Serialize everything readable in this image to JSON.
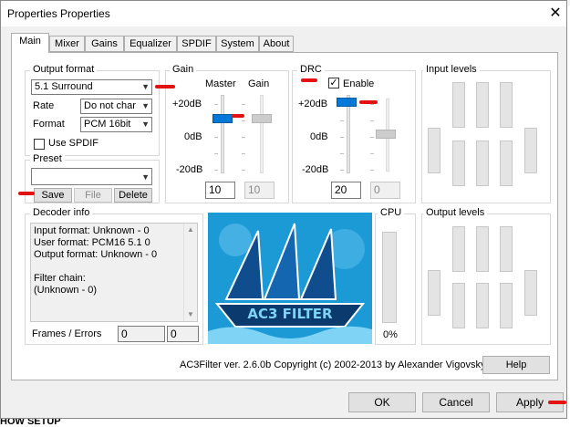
{
  "window": {
    "title": "Properties Properties",
    "close_glyph": "✕"
  },
  "tabs": [
    "Main",
    "Mixer",
    "Gains",
    "Equalizer",
    "SPDIF",
    "System",
    "About"
  ],
  "output_format": {
    "group_label": "Output format",
    "format_value": "5.1 Surround",
    "rate_label": "Rate",
    "rate_value": "Do not char",
    "format_label": "Format",
    "format_select_value": "PCM 16bit",
    "use_spdif_label": "Use SPDIF"
  },
  "preset": {
    "group_label": "Preset",
    "value": "",
    "save_label": "Save",
    "file_label": "File",
    "delete_label": "Delete"
  },
  "gain": {
    "group_label": "Gain",
    "master_label": "Master",
    "gain_label": "Gain",
    "scale_top": "+20dB",
    "scale_mid": "0dB",
    "scale_bottom": "-20dB",
    "master_value": "10",
    "gain_value": "10"
  },
  "drc": {
    "group_label": "DRC",
    "enable_label": "Enable",
    "enable_checked": "✓",
    "scale_top": "+20dB",
    "scale_mid": "0dB",
    "scale_bottom": "-20dB",
    "value": "20",
    "value2": "0"
  },
  "input_levels": {
    "group_label": "Input levels"
  },
  "output_levels": {
    "group_label": "Output levels"
  },
  "decoder": {
    "group_label": "Decoder info",
    "info_text": "Input format: Unknown - 0\nUser format: PCM16 5.1 0\nOutput format: Unknown - 0\n\nFilter chain:\n(Unknown - 0)",
    "frames_label": "Frames / Errors",
    "frames_value": "0",
    "errors_value": "0"
  },
  "cpu": {
    "group_label": "CPU",
    "value": "0%"
  },
  "logo": {
    "text": "AC3 FILTER"
  },
  "footer": {
    "version_text": "AC3Filter ver. 2.6.0b Copyright (c) 2002-2013 by Alexander Vigovsky",
    "help_label": "Help"
  },
  "dialog_buttons": {
    "ok_label": "OK",
    "cancel_label": "Cancel",
    "apply_label": "Apply"
  },
  "background_text": "HOW SETUP",
  "colors": {
    "accent": "#0078d7",
    "marker": "#e31212",
    "logo_bg": "#1c9ad6"
  }
}
